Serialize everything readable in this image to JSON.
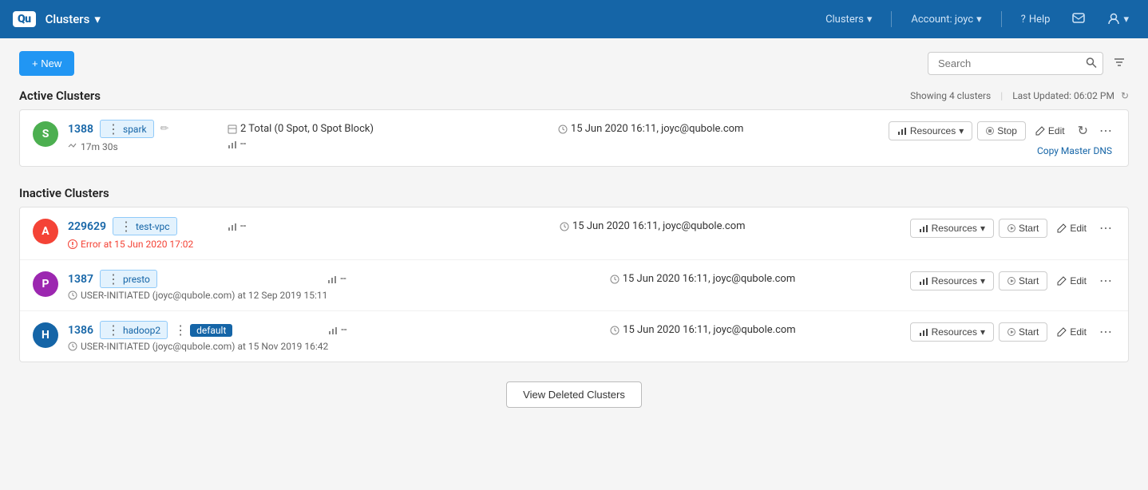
{
  "nav": {
    "logo": "Qu",
    "app_title": "Clusters",
    "dropdown_icon": "▾",
    "clusters_menu": "Clusters",
    "account_menu": "Account: joyc",
    "help_label": "Help",
    "notifications_icon": "message-icon",
    "user_icon": "user-icon"
  },
  "toolbar": {
    "new_button": "+ New",
    "search_placeholder": "Search",
    "filter_icon": "filter-icon"
  },
  "active_section": {
    "title": "Active Clusters",
    "meta": "Showing 4 clusters",
    "last_updated": "Last Updated: 06:02 PM"
  },
  "active_clusters": [
    {
      "id": "1388",
      "avatar_letter": "S",
      "avatar_color": "green",
      "tag": "spark",
      "uptime": "17m 30s",
      "nodes": "2 Total (0 Spot, 0 Spot Block)",
      "timestamp": "15 Jun 2020 16:11, joyc@qubole.com",
      "chart_val": "--",
      "copy_master_dns": "Copy Master DNS",
      "actions": {
        "resources": "Resources",
        "stop": "Stop",
        "edit": "Edit"
      }
    }
  ],
  "inactive_section": {
    "title": "Inactive Clusters"
  },
  "inactive_clusters": [
    {
      "id": "229629",
      "avatar_letter": "A",
      "avatar_color": "red",
      "tag": "test-vpc",
      "error": "Error at 15 Jun 2020 17:02",
      "timestamp": "15 Jun 2020 16:11, joyc@qubole.com",
      "chart_val": "--",
      "actions": {
        "resources": "Resources",
        "start": "Start",
        "edit": "Edit"
      }
    },
    {
      "id": "1387",
      "avatar_letter": "P",
      "avatar_color": "purple",
      "tag": "presto",
      "sub": "USER-INITIATED (joyc@qubole.com) at 12 Sep 2019 15:11",
      "timestamp": "15 Jun 2020 16:11, joyc@qubole.com",
      "chart_val": "--",
      "actions": {
        "resources": "Resources",
        "start": "Start",
        "edit": "Edit"
      }
    },
    {
      "id": "1386",
      "avatar_letter": "H",
      "avatar_color": "dark-blue",
      "tag": "hadoop2",
      "tag2": "default",
      "sub": "USER-INITIATED (joyc@qubole.com) at 15 Nov 2019 16:42",
      "timestamp": "15 Jun 2020 16:11, joyc@qubole.com",
      "chart_val": "--",
      "actions": {
        "resources": "Resources",
        "start": "Start",
        "edit": "Edit"
      }
    }
  ],
  "footer": {
    "view_deleted": "View Deleted Clusters"
  }
}
